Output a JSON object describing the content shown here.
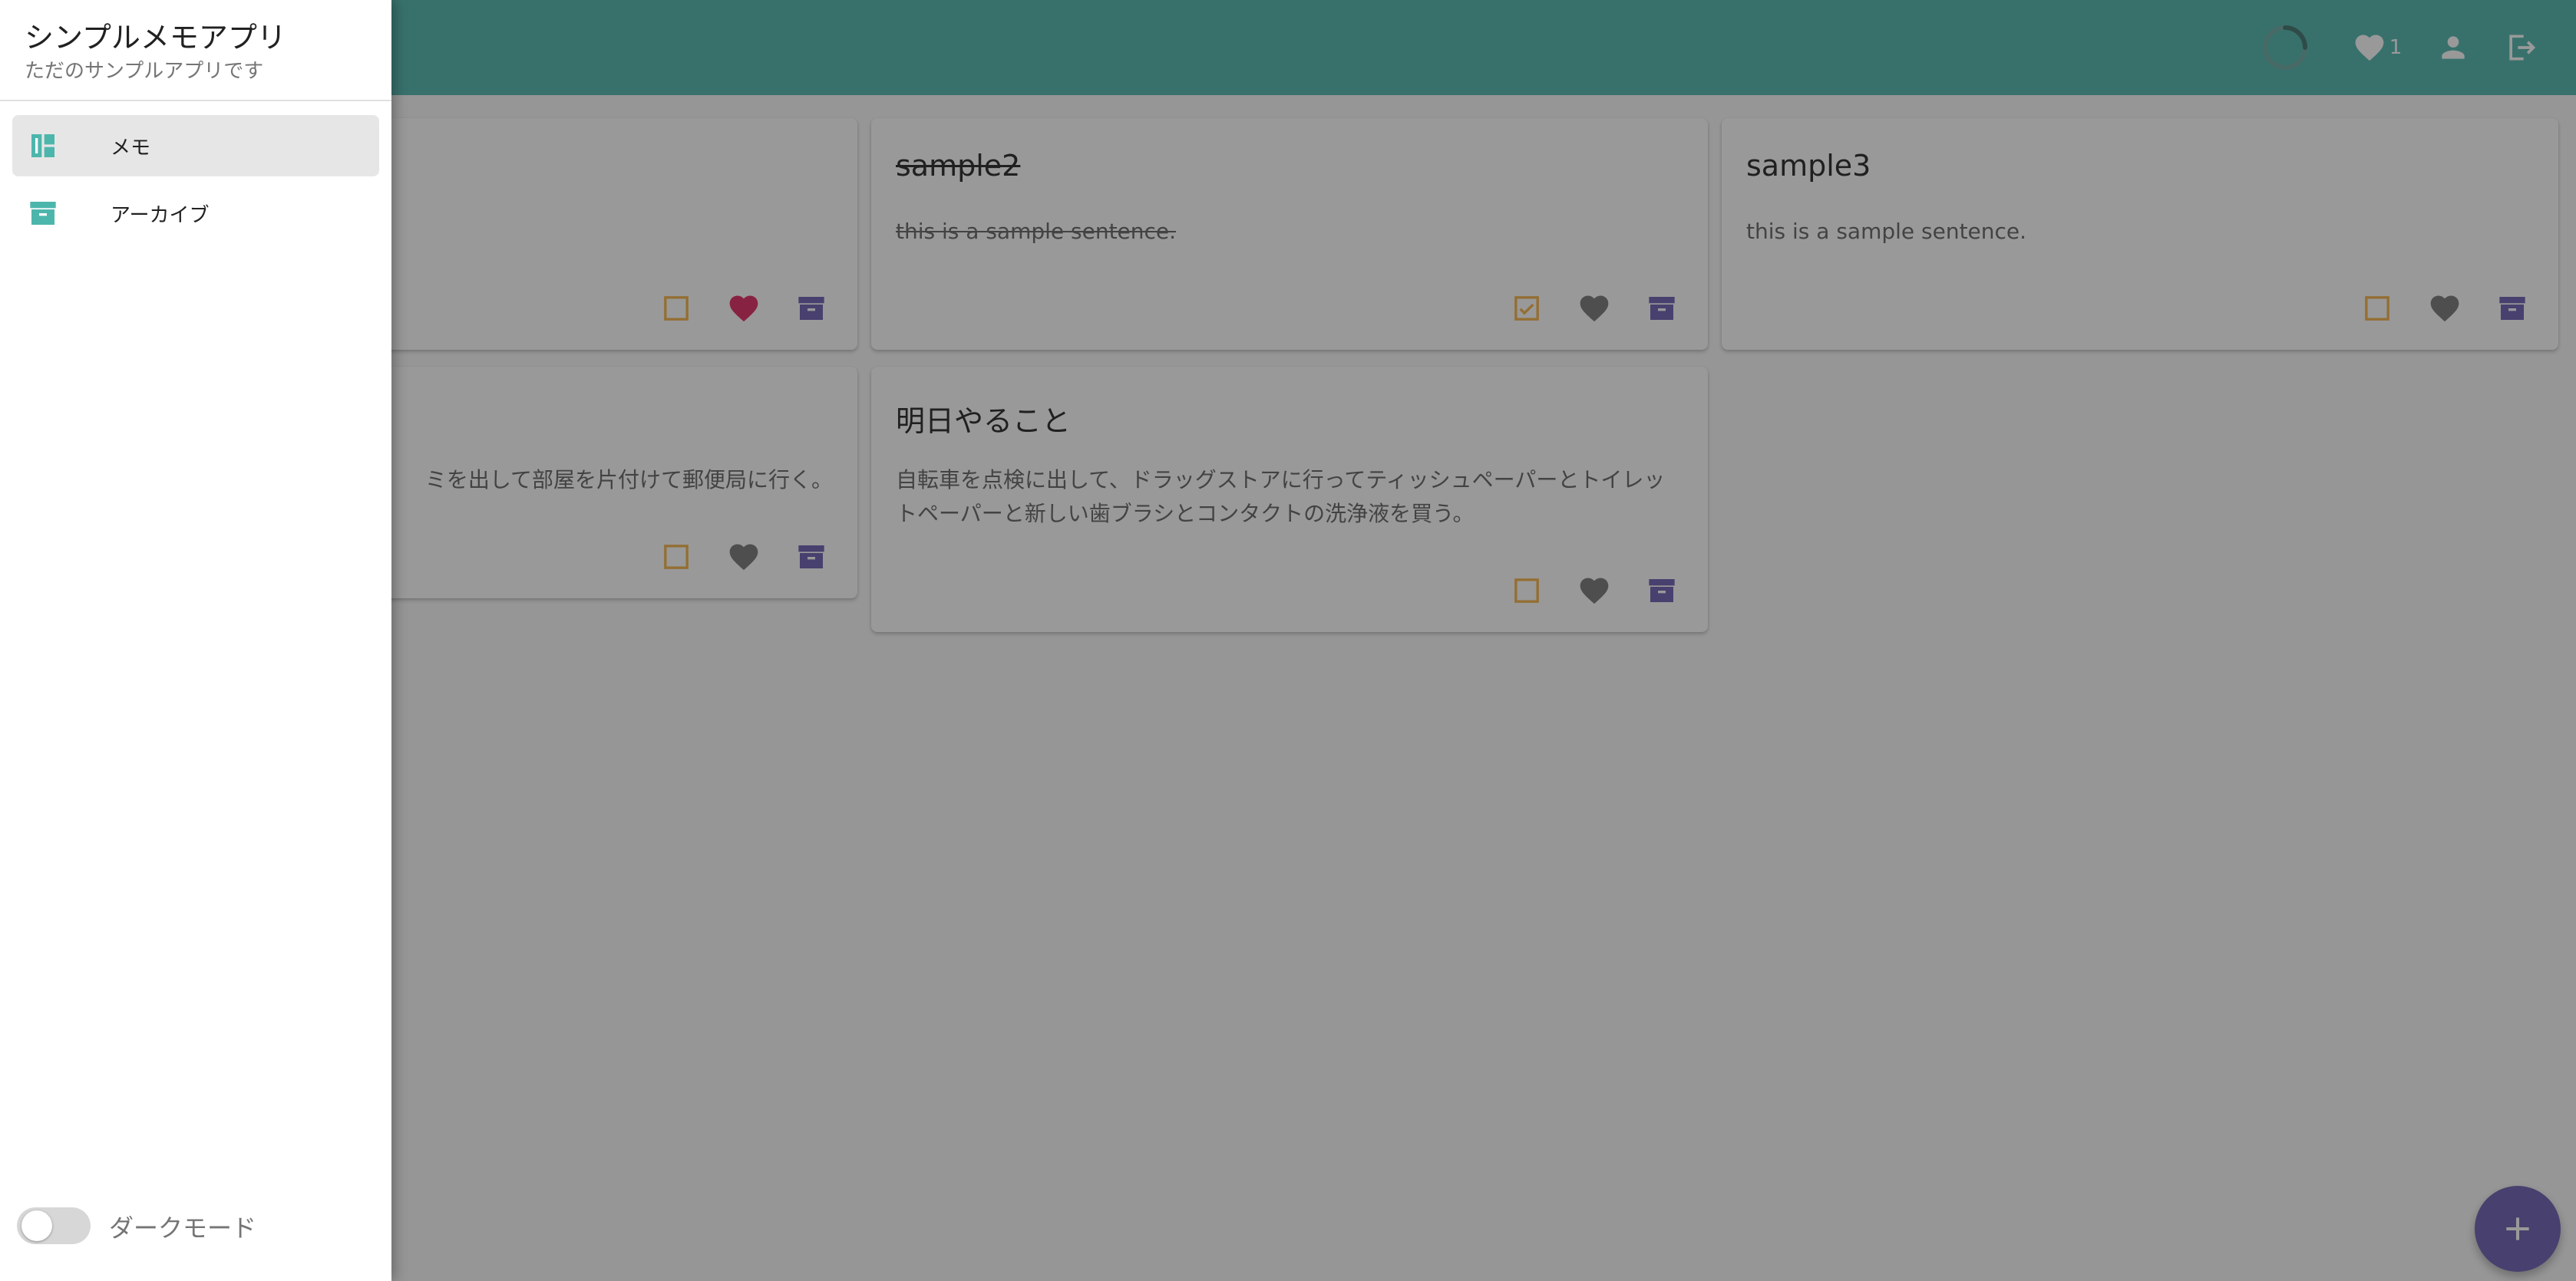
{
  "app": {
    "title": "シンプルメモアプリ",
    "subtitle": "ただのサンプルアプリです"
  },
  "appbar": {
    "favorite_count": "1",
    "icons": [
      "loading-spinner-icon",
      "heart-icon",
      "account-icon",
      "logout-icon"
    ]
  },
  "nav": {
    "items": [
      {
        "label": "メモ",
        "icon": "dashboard-icon",
        "active": true
      },
      {
        "label": "アーカイブ",
        "icon": "archive-icon",
        "active": false
      }
    ]
  },
  "settings": {
    "dark_mode_label": "ダークモード",
    "dark_mode_on": false
  },
  "cards": [
    {
      "title": "",
      "text": "",
      "done": false,
      "favorite": true
    },
    {
      "title": "sample2",
      "text": "this is a sample sentence.",
      "done": true,
      "favorite": false
    },
    {
      "title": "sample3",
      "text": "this is a sample sentence.",
      "done": false,
      "favorite": false
    },
    {
      "title": "",
      "text": "ミを出して部屋を片付けて郵便局に行く。",
      "done": false,
      "favorite": false
    },
    {
      "title": "明日やること",
      "text": "自転車を点検に出して、ドラッグストアに行ってティッシュペーパーとトイレットペーパーと新しい歯ブラシとコンタクトの洗浄液を買う。",
      "done": false,
      "favorite": false
    }
  ],
  "colors": {
    "primary": "#4db6ac",
    "accent": "#6a5cb0",
    "checkbox": "#f5b041",
    "favorite_active": "#e0245e",
    "icon_inactive": "#757575"
  }
}
